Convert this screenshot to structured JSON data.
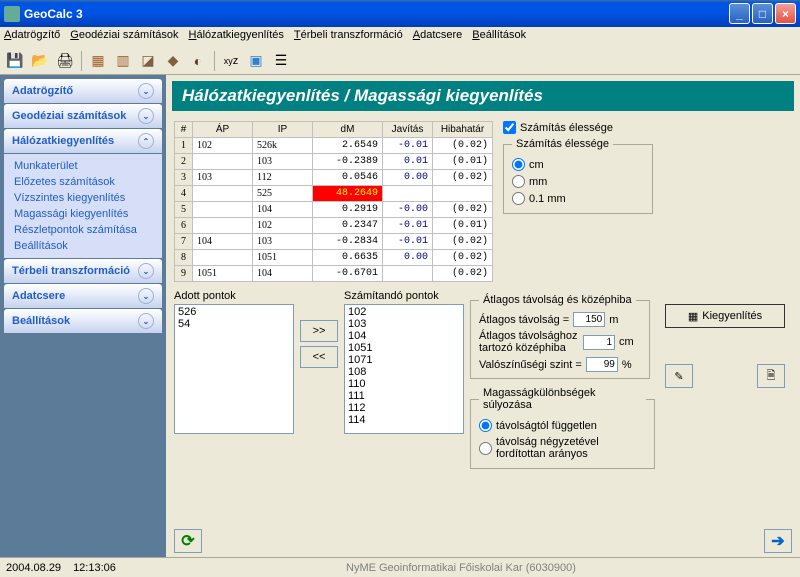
{
  "title": "GeoCalc 3",
  "menu": [
    "Adatrögzítő",
    "Geodéziai számítások",
    "Hálózatkiegyenlítés",
    "Térbeli transzformáció",
    "Adatcsere",
    "Beállítások"
  ],
  "sidebar": [
    {
      "label": "Adatrögzítő",
      "expanded": false,
      "chev": "⌄"
    },
    {
      "label": "Geodéziai számítások",
      "expanded": false,
      "chev": "⌄"
    },
    {
      "label": "Hálózatkiegyenlítés",
      "expanded": true,
      "chev": "⌃",
      "items": [
        "Munkaterület",
        "Előzetes számítások",
        "Vízszintes kiegyenlítés",
        "Magassági kiegyenlítés",
        "Részletpontok számítása",
        "Beállítások"
      ]
    },
    {
      "label": "Térbeli transzformáció",
      "expanded": false,
      "chev": "⌄"
    },
    {
      "label": "Adatcsere",
      "expanded": false,
      "chev": "⌄"
    },
    {
      "label": "Beállítások",
      "expanded": false,
      "chev": "⌄"
    }
  ],
  "page_title": "Hálózatkiegyenlítés / Magassági kiegyenlítés",
  "table": {
    "headers": [
      "#",
      "ÁP",
      "IP",
      "dM",
      "Javítás",
      "Hibahatár"
    ],
    "rows": [
      {
        "n": 1,
        "ap": "102",
        "ip": "526k",
        "dm": "2.6549",
        "jav": "-0.01",
        "hh": "(0.02)"
      },
      {
        "n": 2,
        "ap": "",
        "ip": "103",
        "dm": "-0.2389",
        "jav": "0.01",
        "hh": "(0.01)"
      },
      {
        "n": 3,
        "ap": "103",
        "ip": "112",
        "dm": "0.0546",
        "jav": "0.00",
        "hh": "(0.02)"
      },
      {
        "n": 4,
        "ap": "",
        "ip": "525",
        "dm": "48.2649",
        "jav": "",
        "hh": "",
        "red": true
      },
      {
        "n": 5,
        "ap": "",
        "ip": "104",
        "dm": "0.2919",
        "jav": "-0.00",
        "hh": "(0.02)"
      },
      {
        "n": 6,
        "ap": "",
        "ip": "102",
        "dm": "0.2347",
        "jav": "-0.01",
        "hh": "(0.01)"
      },
      {
        "n": 7,
        "ap": "104",
        "ip": "103",
        "dm": "-0.2834",
        "jav": "-0.01",
        "hh": "(0.02)"
      },
      {
        "n": 8,
        "ap": "",
        "ip": "1051",
        "dm": "0.6635",
        "jav": "0.00",
        "hh": "(0.02)"
      },
      {
        "n": 9,
        "ap": "1051",
        "ip": "104",
        "dm": "-0.6701",
        "jav": "",
        "hh": "(0.02)"
      }
    ]
  },
  "sharpness_check": "Számítás élessége",
  "sharpness_group": {
    "label": "Számítás élessége",
    "opts": [
      "cm",
      "mm",
      "0.1 mm"
    ]
  },
  "adott_label": "Adott pontok",
  "adott_items": [
    "526",
    "54"
  ],
  "szamitando_label": "Számítandó pontok",
  "szamitando_items": [
    "102",
    "103",
    "104",
    "1051",
    "1071",
    "108",
    "110",
    "111",
    "112",
    "114"
  ],
  "move_right": ">>",
  "move_left": "<<",
  "atlagos_group": {
    "label": "Átlagos távolság és középhiba",
    "row1": "Átlagos távolság =",
    "val1": "150",
    "unit1": "m",
    "row2": "Átlagos távolsághoz tartozó középhiba",
    "val2": "1",
    "unit2": "cm",
    "row3": "Valószínűségi szint =",
    "val3": "99",
    "unit3": "%"
  },
  "sulyozas_group": {
    "label": "Magasságkülönbségek súlyozása",
    "opt1": "távolságtól független",
    "opt2": "távolság négyzetével fordítottan arányos"
  },
  "kiegyenlites_btn": "Kiegyenlítés",
  "status": {
    "date": "2004.08.29",
    "time": "12:13:06",
    "org": "NyME Geoinformatikai Főiskolai Kar (6030900)"
  }
}
